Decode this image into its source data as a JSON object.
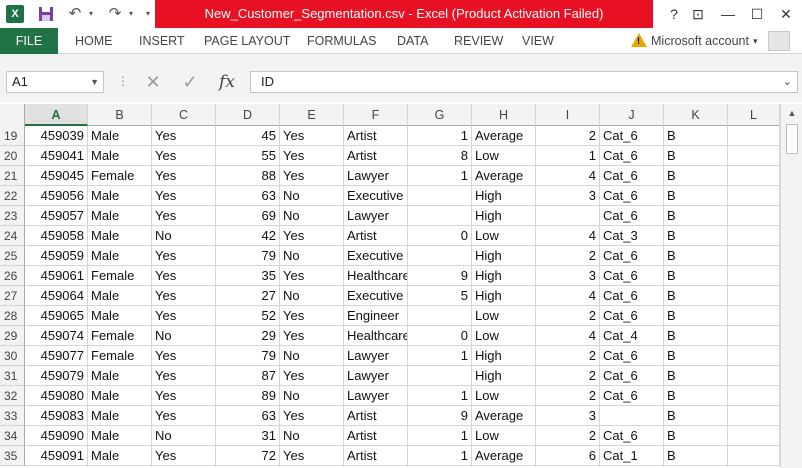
{
  "window": {
    "title": "New_Customer_Segmentation.csv -  Excel (Product Activation Failed)",
    "help": "?",
    "ribbon_display": "⊡",
    "minimize": "—",
    "maximize": "☐",
    "close": "✕"
  },
  "qat": {
    "excel_icon": "X",
    "save_icon": "save-icon",
    "undo_icon": "undo-icon",
    "redo_icon": "redo-icon"
  },
  "ribbon": {
    "tabs": [
      "FILE",
      "HOME",
      "INSERT",
      "PAGE LAYOUT",
      "FORMULAS",
      "DATA",
      "REVIEW",
      "VIEW"
    ],
    "account": "Microsoft account"
  },
  "formula_bar": {
    "name_box": "A1",
    "cancel_glyph": "✕",
    "enter_glyph": "✓",
    "fx": "fx",
    "content": "ID"
  },
  "grid": {
    "columns": [
      "A",
      "B",
      "C",
      "D",
      "E",
      "F",
      "G",
      "H",
      "I",
      "J",
      "K",
      "L"
    ],
    "rows": [
      {
        "n": "19",
        "cells": [
          "459039",
          "Male",
          "Yes",
          "45",
          "Yes",
          "Artist",
          "1",
          "Average",
          "2",
          "Cat_6",
          "B",
          ""
        ]
      },
      {
        "n": "20",
        "cells": [
          "459041",
          "Male",
          "Yes",
          "55",
          "Yes",
          "Artist",
          "8",
          "Low",
          "1",
          "Cat_6",
          "B",
          ""
        ]
      },
      {
        "n": "21",
        "cells": [
          "459045",
          "Female",
          "Yes",
          "88",
          "Yes",
          "Lawyer",
          "1",
          "Average",
          "4",
          "Cat_6",
          "B",
          ""
        ]
      },
      {
        "n": "22",
        "cells": [
          "459056",
          "Male",
          "Yes",
          "63",
          "No",
          "Executive",
          "",
          "High",
          "3",
          "Cat_6",
          "B",
          ""
        ]
      },
      {
        "n": "23",
        "cells": [
          "459057",
          "Male",
          "Yes",
          "69",
          "No",
          "Lawyer",
          "",
          "High",
          "",
          "Cat_6",
          "B",
          ""
        ]
      },
      {
        "n": "24",
        "cells": [
          "459058",
          "Male",
          "No",
          "42",
          "Yes",
          "Artist",
          "0",
          "Low",
          "4",
          "Cat_3",
          "B",
          ""
        ]
      },
      {
        "n": "25",
        "cells": [
          "459059",
          "Male",
          "Yes",
          "79",
          "No",
          "Executive",
          "",
          "High",
          "2",
          "Cat_6",
          "B",
          ""
        ]
      },
      {
        "n": "26",
        "cells": [
          "459061",
          "Female",
          "Yes",
          "35",
          "Yes",
          "Healthcare",
          "9",
          "High",
          "3",
          "Cat_6",
          "B",
          ""
        ]
      },
      {
        "n": "27",
        "cells": [
          "459064",
          "Male",
          "Yes",
          "27",
          "No",
          "Executive",
          "5",
          "High",
          "4",
          "Cat_6",
          "B",
          ""
        ]
      },
      {
        "n": "28",
        "cells": [
          "459065",
          "Male",
          "Yes",
          "52",
          "Yes",
          "Engineer",
          "",
          "Low",
          "2",
          "Cat_6",
          "B",
          ""
        ]
      },
      {
        "n": "29",
        "cells": [
          "459074",
          "Female",
          "No",
          "29",
          "Yes",
          "Healthcare",
          "0",
          "Low",
          "4",
          "Cat_4",
          "B",
          ""
        ]
      },
      {
        "n": "30",
        "cells": [
          "459077",
          "Female",
          "Yes",
          "79",
          "No",
          "Lawyer",
          "1",
          "High",
          "2",
          "Cat_6",
          "B",
          ""
        ]
      },
      {
        "n": "31",
        "cells": [
          "459079",
          "Male",
          "Yes",
          "87",
          "Yes",
          "Lawyer",
          "",
          "High",
          "2",
          "Cat_6",
          "B",
          ""
        ]
      },
      {
        "n": "32",
        "cells": [
          "459080",
          "Male",
          "Yes",
          "89",
          "No",
          "Lawyer",
          "1",
          "Low",
          "2",
          "Cat_6",
          "B",
          ""
        ]
      },
      {
        "n": "33",
        "cells": [
          "459083",
          "Male",
          "Yes",
          "63",
          "Yes",
          "Artist",
          "9",
          "Average",
          "3",
          "",
          "B",
          ""
        ]
      },
      {
        "n": "34",
        "cells": [
          "459090",
          "Male",
          "No",
          "31",
          "No",
          "Artist",
          "1",
          "Low",
          "2",
          "Cat_6",
          "B",
          ""
        ]
      },
      {
        "n": "35",
        "cells": [
          "459091",
          "Male",
          "Yes",
          "72",
          "Yes",
          "Artist",
          "1",
          "Average",
          "6",
          "Cat_1",
          "B",
          ""
        ]
      }
    ]
  },
  "colors": {
    "excel_green": "#217346",
    "title_red": "#e81123",
    "warning": "#e8a800"
  }
}
